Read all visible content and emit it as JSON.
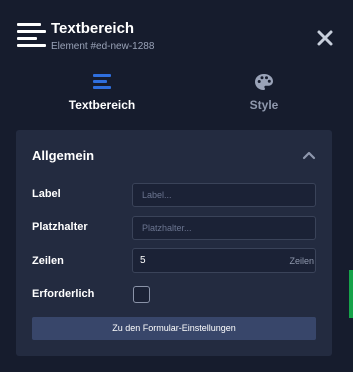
{
  "header": {
    "title": "Textbereich",
    "subtitle": "Element #ed-new-1288",
    "icon": "textarea-icon",
    "close_icon": "close-icon"
  },
  "tabs": [
    {
      "label": "Textbereich",
      "icon": "text-lines-icon",
      "active": true,
      "accent": "#2f6fde"
    },
    {
      "label": "Style",
      "icon": "palette-icon",
      "active": false
    }
  ],
  "section": {
    "title": "Allgemein",
    "collapse_icon": "chevron-up-icon",
    "fields": {
      "label": {
        "label": "Label",
        "placeholder": "Label...",
        "value": ""
      },
      "placeholder": {
        "label": "Platzhalter",
        "placeholder": "Platzhalter...",
        "value": ""
      },
      "rows": {
        "label": "Zeilen",
        "value": "5",
        "unit": "Zeilen"
      },
      "required": {
        "label": "Erforderlich",
        "checked": false
      }
    },
    "button_label": "Zu den Formular-Einstellungen"
  },
  "colors": {
    "background": "#161c2d",
    "panel": "#232b40",
    "button": "#38466a",
    "accent": "#2f6fde"
  }
}
